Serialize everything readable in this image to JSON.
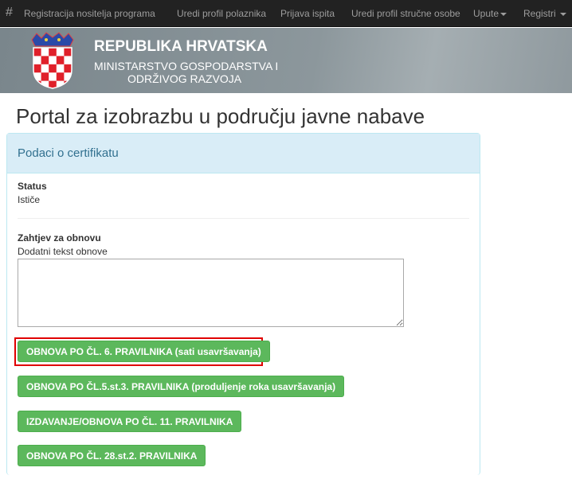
{
  "nav": {
    "brand": "#",
    "items": [
      "Registracija nositelja programa",
      "Uredi profil polaznika",
      "Prijava ispita",
      "Uredi profil stručne osobe"
    ],
    "dropdowns": [
      "Upute",
      "Registri"
    ]
  },
  "banner": {
    "title": "REPUBLIKA HRVATSKA",
    "subtitle_line1": "MINISTARSTVO GOSPODARSTVA I",
    "subtitle_line2": "ODRŽIVOG RAZVOJA"
  },
  "page": {
    "title": "Portal za izobrazbu u području javne nabave"
  },
  "panel": {
    "heading": "Podaci o certifikatu",
    "status_label": "Status",
    "status_value": "Ističe",
    "request_label": "Zahtjev za obnovu",
    "textarea_label": "Dodatni tekst obnove",
    "textarea_value": "",
    "buttons": [
      "OBNOVA PO ČL. 6. PRAVILNIKA (sati usavršavanja)",
      "OBNOVA PO ČL.5.st.3. PRAVILNIKA (produljenje roka usavršavanja)",
      "IZDAVANJE/OBNOVA PO ČL. 11. PRAVILNIKA",
      "OBNOVA PO ČL. 28.st.2. PRAVILNIKA"
    ]
  },
  "colors": {
    "button": "#5cb85c",
    "panel_heading": "#d9edf7",
    "highlight": "#e00000"
  }
}
